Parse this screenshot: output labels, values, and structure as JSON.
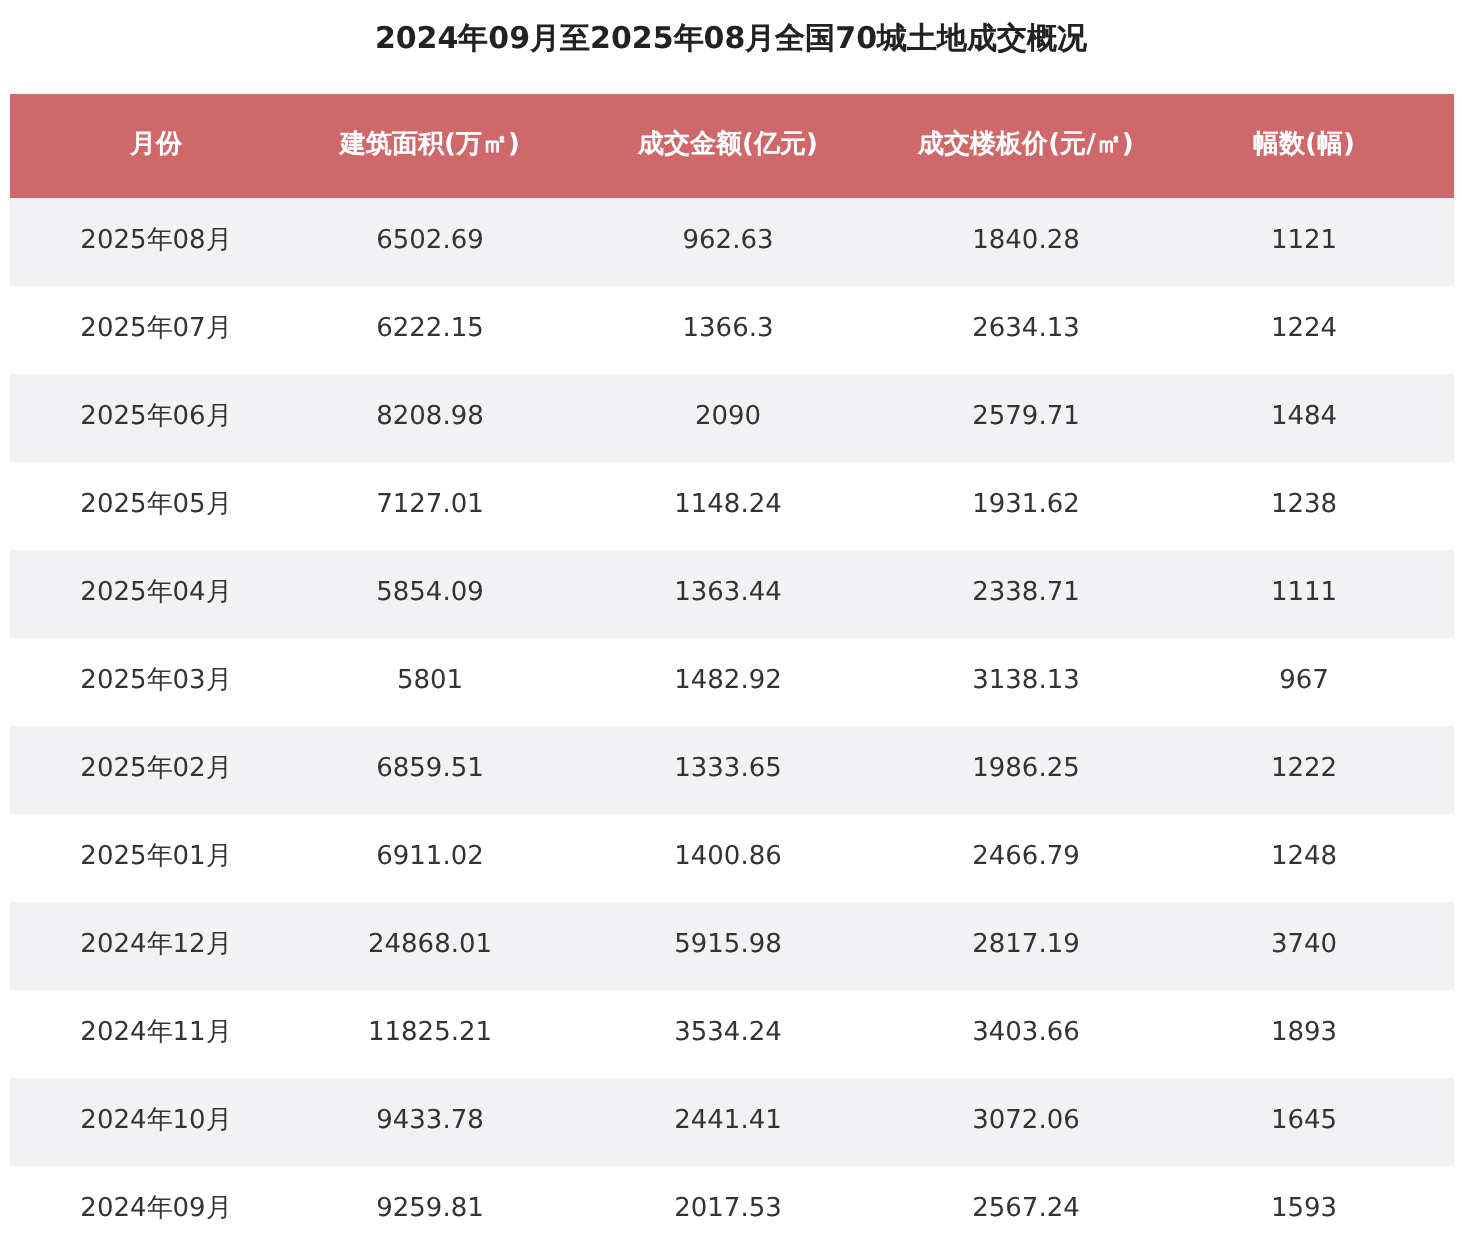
{
  "title": "2024年09月至2025年08月全国70城土地成交概况",
  "table": {
    "columns": [
      "月份",
      "建筑面积(万㎡)",
      "成交金额(亿元)",
      "成交楼板价(元/㎡)",
      "幅数(幅)"
    ],
    "rows": [
      [
        "2025年08月",
        "6502.69",
        "962.63",
        "1840.28",
        "1121"
      ],
      [
        "2025年07月",
        "6222.15",
        "1366.3",
        "2634.13",
        "1224"
      ],
      [
        "2025年06月",
        "8208.98",
        "2090",
        "2579.71",
        "1484"
      ],
      [
        "2025年05月",
        "7127.01",
        "1148.24",
        "1931.62",
        "1238"
      ],
      [
        "2025年04月",
        "5854.09",
        "1363.44",
        "2338.71",
        "1111"
      ],
      [
        "2025年03月",
        "5801",
        "1482.92",
        "3138.13",
        "967"
      ],
      [
        "2025年02月",
        "6859.51",
        "1333.65",
        "1986.25",
        "1222"
      ],
      [
        "2025年01月",
        "6911.02",
        "1400.86",
        "2466.79",
        "1248"
      ],
      [
        "2024年12月",
        "24868.01",
        "5915.98",
        "2817.19",
        "3740"
      ],
      [
        "2024年11月",
        "11825.21",
        "3534.24",
        "3403.66",
        "1893"
      ],
      [
        "2024年10月",
        "9433.78",
        "2441.41",
        "3072.06",
        "1645"
      ],
      [
        "2024年09月",
        "9259.81",
        "2017.53",
        "2567.24",
        "1593"
      ]
    ]
  }
}
